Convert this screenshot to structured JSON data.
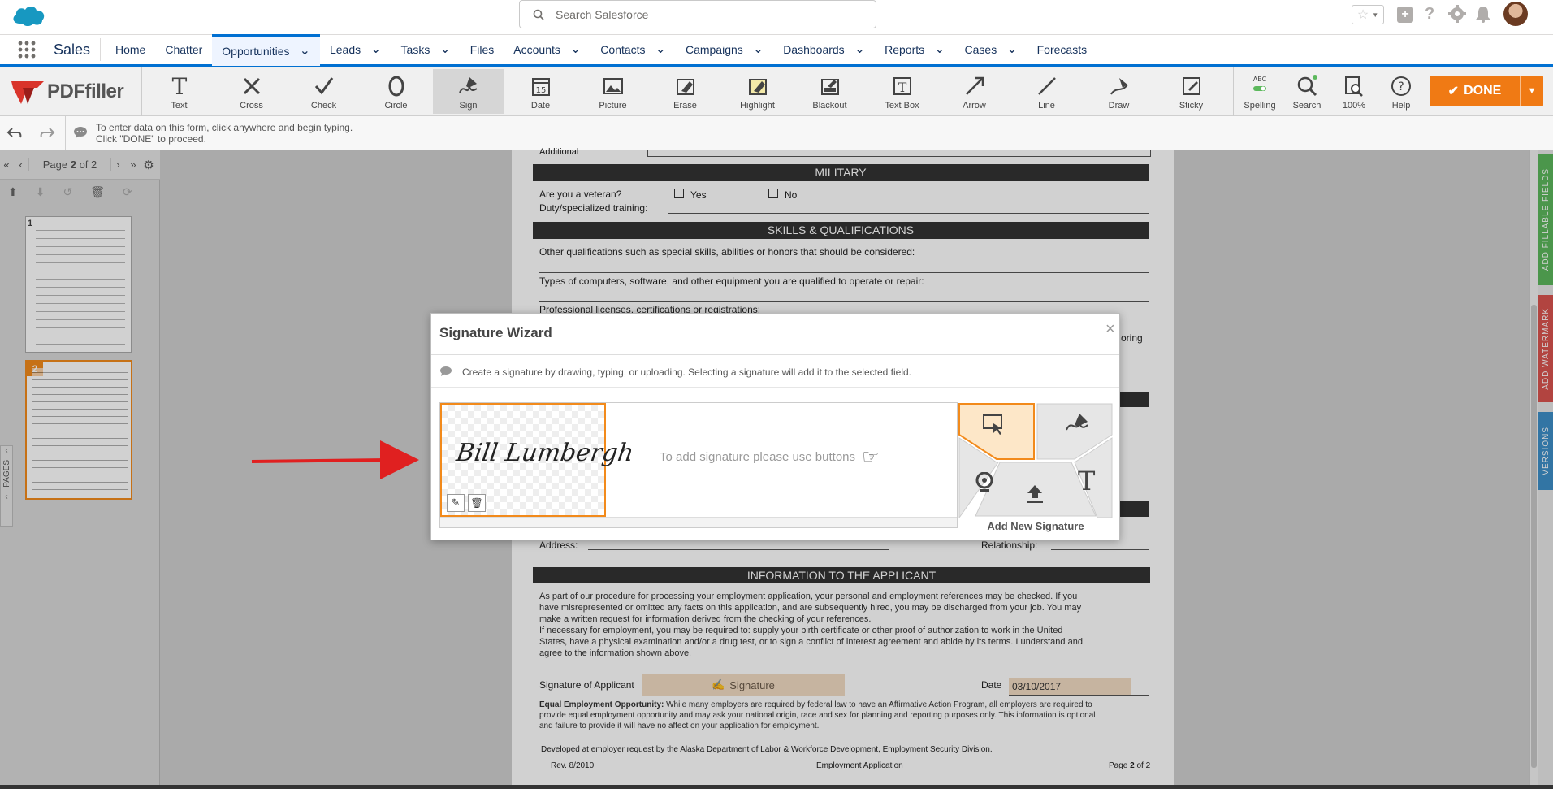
{
  "header": {
    "search_placeholder": "Search Salesforce"
  },
  "nav": {
    "app_name": "Sales",
    "items": [
      {
        "label": "Home",
        "has_menu": false
      },
      {
        "label": "Chatter",
        "has_menu": false
      },
      {
        "label": "Opportunities",
        "has_menu": true,
        "active": true
      },
      {
        "label": "Leads",
        "has_menu": true
      },
      {
        "label": "Tasks",
        "has_menu": true
      },
      {
        "label": "Files",
        "has_menu": false
      },
      {
        "label": "Accounts",
        "has_menu": true
      },
      {
        "label": "Contacts",
        "has_menu": true
      },
      {
        "label": "Campaigns",
        "has_menu": true
      },
      {
        "label": "Dashboards",
        "has_menu": true
      },
      {
        "label": "Reports",
        "has_menu": true
      },
      {
        "label": "Cases",
        "has_menu": true
      },
      {
        "label": "Forecasts",
        "has_menu": false
      }
    ]
  },
  "toolbar": {
    "logo_text": "PDFfiller",
    "tools": [
      {
        "label": "Text",
        "icon": "text-icon"
      },
      {
        "label": "Cross",
        "icon": "cross-icon"
      },
      {
        "label": "Check",
        "icon": "check-icon"
      },
      {
        "label": "Circle",
        "icon": "circle-icon"
      },
      {
        "label": "Sign",
        "icon": "sign-icon",
        "active": true
      },
      {
        "label": "Date",
        "icon": "date-icon"
      },
      {
        "label": "Picture",
        "icon": "picture-icon"
      },
      {
        "label": "Erase",
        "icon": "erase-icon"
      },
      {
        "label": "Highlight",
        "icon": "highlight-icon"
      },
      {
        "label": "Blackout",
        "icon": "blackout-icon"
      },
      {
        "label": "Text Box",
        "icon": "textbox-icon"
      },
      {
        "label": "Arrow",
        "icon": "arrow-icon"
      },
      {
        "label": "Line",
        "icon": "line-icon"
      },
      {
        "label": "Draw",
        "icon": "draw-icon"
      },
      {
        "label": "Sticky",
        "icon": "sticky-icon"
      }
    ],
    "right_tools": [
      {
        "label": "Spelling",
        "icon": "spelling-icon",
        "badge": "ABC"
      },
      {
        "label": "Search",
        "icon": "search-icon"
      },
      {
        "label": "100%",
        "icon": "zoom-icon"
      },
      {
        "label": "Help",
        "icon": "help-icon"
      }
    ],
    "done_label": "DONE"
  },
  "hint": {
    "line1": "To enter data on this form, click anywhere and begin typing.",
    "line2": "Click \"DONE\" to proceed."
  },
  "pager": {
    "page_label": "Page",
    "current_page": "2",
    "of_label": "of 2",
    "pages_tab": "PAGES",
    "thumbnails": [
      "1",
      "2"
    ]
  },
  "right_rail": {
    "tabs": [
      "ADD FILLABLE FIELDS",
      "ADD WATERMARK",
      "VERSIONS"
    ],
    "colors": [
      "#5cb85c",
      "#d9534f",
      "#3d8fc9"
    ]
  },
  "document": {
    "additional_label": "Additional",
    "military_title": "MILITARY",
    "veteran_q": "Are you a veteran?",
    "yes": "Yes",
    "no": "No",
    "duty_label": "Duty/specialized training:",
    "skills_title": "SKILLS & QUALIFICATIONS",
    "q1": "Other qualifications such as special skills, abilities or honors that should be considered:",
    "q2": "Types of computers, software, and other equipment you are qualified to operate or repair:",
    "q3": "Professional licenses, certifications or registrations:",
    "bring_fragment": "oring",
    "address_label": "Address:",
    "relationship_label": "Relationship:",
    "info_title": "INFORMATION TO THE APPLICANT",
    "para1": [
      "As part of our procedure for processing your employment application, your personal and employment references may be checked. If you",
      "have misrepresented or omitted any facts on this application, and are subsequently hired, you may be discharged from your job. You may",
      "make a written request for information derived from the checking of your references."
    ],
    "para2": [
      "If necessary for employment, you may be required to: supply your birth certificate or other proof of authorization to work in the United",
      "States, have a physical examination and/or a drug test, or to sign a conflict of interest agreement and abide by its terms. I understand and",
      "agree to the information shown above."
    ],
    "signature_label": "Signature of Applicant",
    "signature_field": "Signature",
    "date_label": "Date",
    "date_value": "03/10/2017",
    "eeo_bold": "Equal Employment Opportunity:",
    "eeo_lines": [
      " While many employers are required by federal law to have an Affirmative Action Program, all employers are required to",
      "provide equal employment opportunity and may ask your national origin, race and sex for planning and reporting purposes only. This information is optional",
      "and failure to provide it will have no affect on your application for employment."
    ],
    "developed": "Developed at employer request by the Alaska Department of Labor & Workforce Development, Employment Security Division.",
    "rev": "Rev. 8/2010",
    "footer_center": "Employment Application",
    "footer_page": "Page",
    "footer_page_num": "2",
    "footer_of": "of 2"
  },
  "wizard": {
    "title": "Signature Wizard",
    "info": "Create a signature by drawing, typing, or uploading. Selecting a signature will add it to the selected field.",
    "signature_text": "Bill Lumbergh",
    "placeholder": "To add signature please use buttons",
    "add_new": "Add New Signature"
  }
}
